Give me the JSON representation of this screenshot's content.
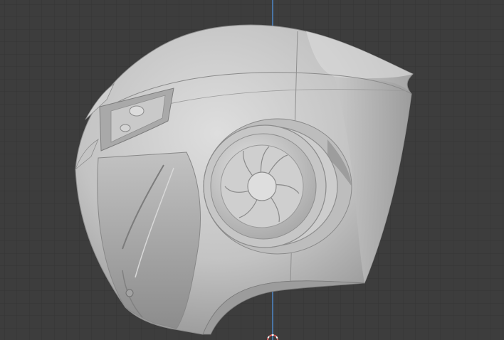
{
  "viewport": {
    "background": "#3d3d3d",
    "grid_minor_color": "#353535",
    "grid_major_color": "#2e2e2e",
    "axis_color": "#4f86c6",
    "model_base_color": "#b9b9b9",
    "model_shadow_color": "#8a8a8a",
    "model_highlight_color": "#e4e4e4",
    "origin_icon": "3d-cursor-icon"
  }
}
